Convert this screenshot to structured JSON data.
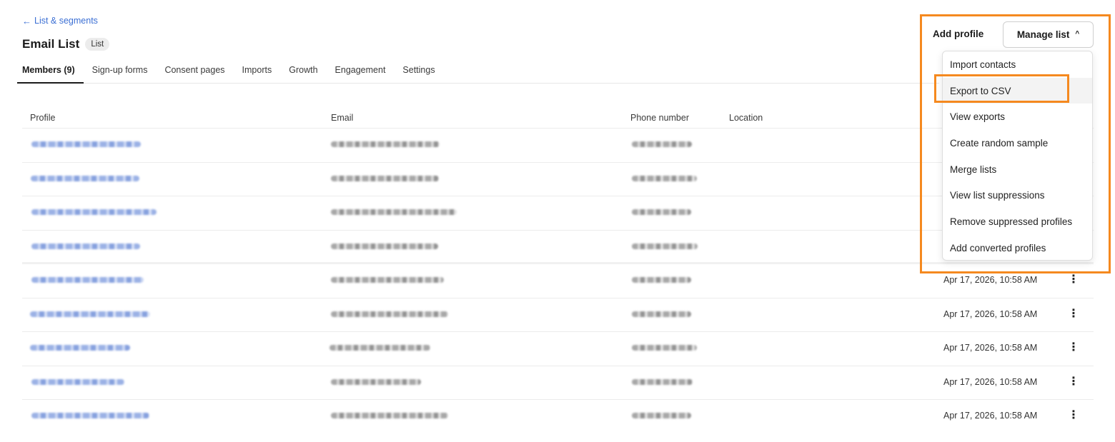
{
  "header": {
    "back_link": "List & segments",
    "title": "Email List",
    "badge": "List"
  },
  "tabs": [
    {
      "label": "Members (9)"
    },
    {
      "label": "Sign-up forms"
    },
    {
      "label": "Consent pages"
    },
    {
      "label": "Imports"
    },
    {
      "label": "Growth"
    },
    {
      "label": "Engagement"
    },
    {
      "label": "Settings"
    }
  ],
  "actions": {
    "add_profile": "Add profile",
    "manage_list": "Manage list"
  },
  "menu": {
    "items": [
      {
        "label": "Import contacts"
      },
      {
        "label": "Export to CSV"
      },
      {
        "label": "View exports"
      },
      {
        "label": "Create random sample"
      },
      {
        "label": "Merge lists"
      },
      {
        "label": "View list suppressions"
      },
      {
        "label": "Remove suppressed profiles"
      },
      {
        "label": "Add converted profiles"
      }
    ]
  },
  "table": {
    "columns": {
      "profile": "Profile",
      "email": "Email",
      "phone": "Phone number",
      "location": "Location"
    },
    "rows": [
      {
        "date": ""
      },
      {
        "date": ""
      },
      {
        "date": ""
      },
      {
        "date": ""
      },
      {
        "date": "Apr 17, 2026, 10:58 AM"
      },
      {
        "date": "Apr 17, 2026, 10:58 AM"
      },
      {
        "date": "Apr 17, 2026, 10:58 AM"
      },
      {
        "date": "Apr 17, 2026, 10:58 AM"
      },
      {
        "date": "Apr 17, 2026, 10:58 AM"
      }
    ]
  },
  "colors": {
    "link": "#3b6fd4",
    "highlight": "#f5891f"
  },
  "icons": {
    "back": "arrow-left-icon",
    "chevron": "chevron-up-icon",
    "row_menu": "kebab-icon"
  }
}
